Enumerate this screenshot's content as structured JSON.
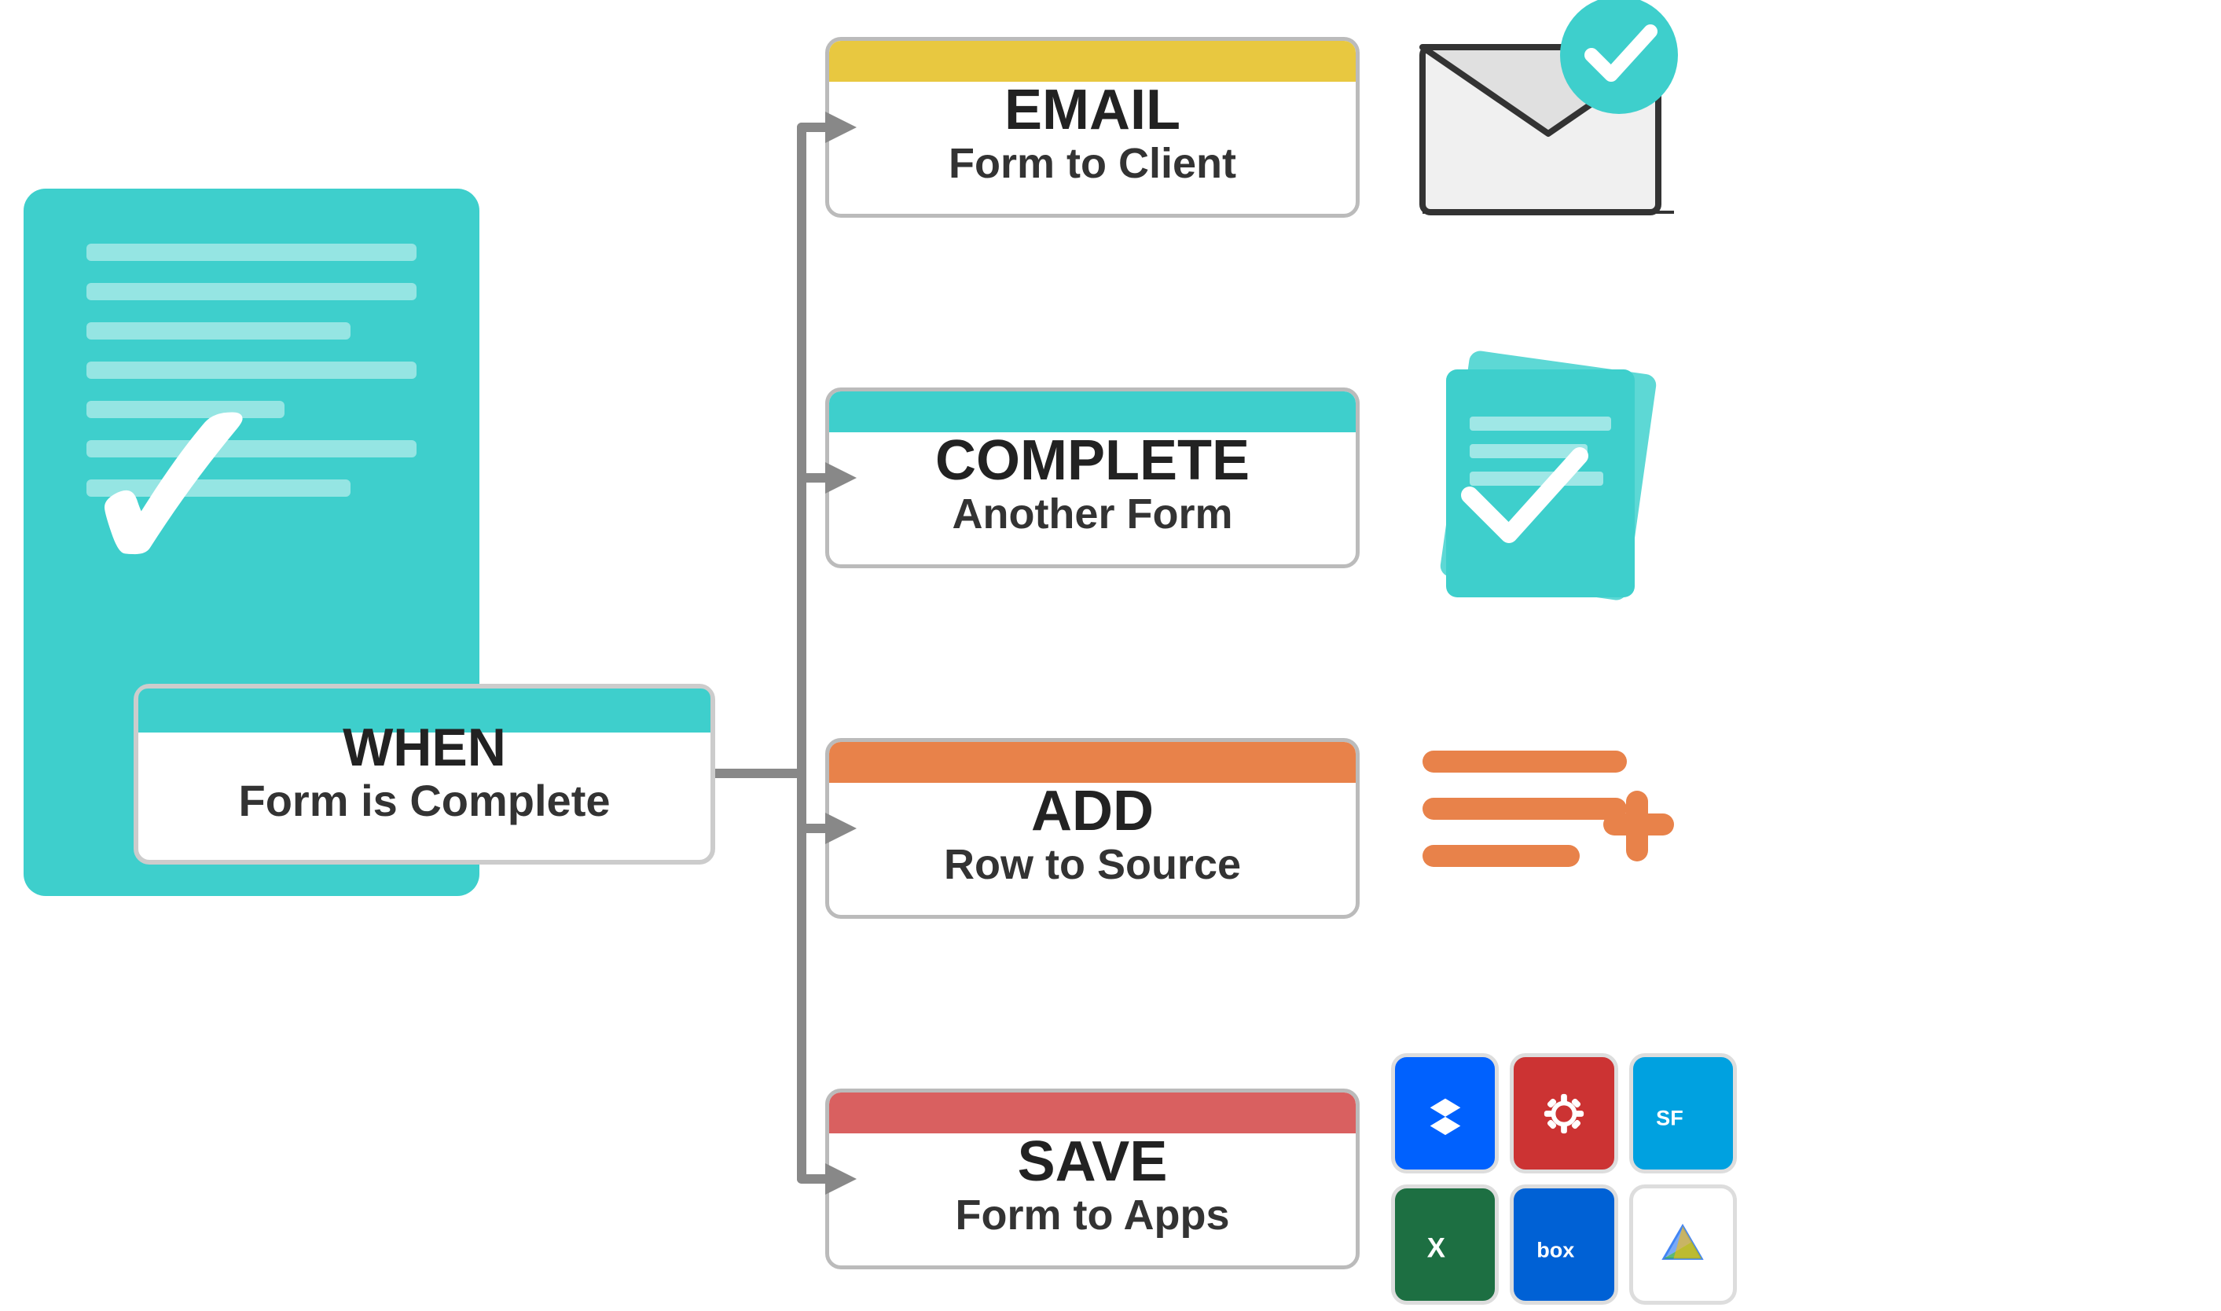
{
  "form_card": {
    "background": "#3ecfcc"
  },
  "when_box": {
    "label_top": "WHEN",
    "label_bottom": "Form is Complete",
    "header_color": "#3ecfcc"
  },
  "action_boxes": [
    {
      "id": "email",
      "label_top": "EMAIL",
      "label_bottom": "Form to Client",
      "header_color": "#e8c840",
      "position": "email"
    },
    {
      "id": "complete",
      "label_top": "COMPLETE",
      "label_bottom": "Another Form",
      "header_color": "#3ecfcc",
      "position": "complete"
    },
    {
      "id": "add",
      "label_top": "ADD",
      "label_bottom": "Row to Source",
      "header_color": "#e8824a",
      "position": "add"
    },
    {
      "id": "save",
      "label_top": "SAVE",
      "label_bottom": "Form to Apps",
      "header_color": "#d96060",
      "position": "save"
    }
  ],
  "connector": {
    "color": "#888",
    "stroke_width": "12"
  },
  "apps": {
    "dropbox_color": "#0061fe",
    "cog_color": "#e55",
    "salesforce_color": "#00a1e0",
    "excel_color": "#1d6f42",
    "box_color": "#0061d5",
    "drive_color": "#fff"
  }
}
